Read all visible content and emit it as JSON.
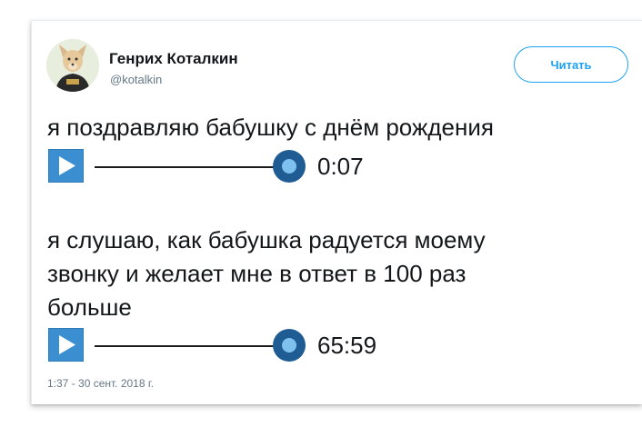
{
  "author": {
    "name": "Генрих Коталкин",
    "handle": "@kotalkin"
  },
  "follow_button": {
    "label": "Читать"
  },
  "tweet": {
    "lines": [
      "я поздравляю бабушку с днём рождения",
      "я слушаю, как бабушка радуется моему",
      "звонку и желает мне в ответ в 100 раз",
      "больше"
    ],
    "voice_messages": [
      {
        "duration": "0:07"
      },
      {
        "duration": "65:59"
      }
    ]
  },
  "timestamp": "1:37 - 30 сент. 2018 г.",
  "colors": {
    "accent": "#1da1f2",
    "play_button": "#3b8fd1",
    "knob": "#1e5c93",
    "knob_center": "#7ec1ee"
  }
}
